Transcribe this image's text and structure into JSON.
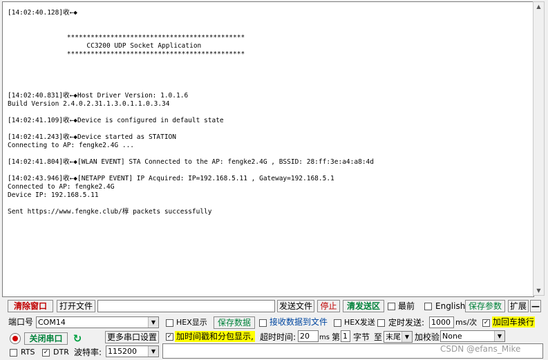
{
  "terminal": {
    "lines": [
      "[14:02:40.128]收←◆",
      "",
      "",
      "               *********************************************",
      "                    CC3200 UDP Socket Application",
      "               *********************************************",
      "",
      "",
      "",
      "",
      "[14:02:40.831]收←◆Host Driver Version: 1.0.1.6",
      "Build Version 2.4.0.2.31.1.3.0.1.1.0.3.34",
      "",
      "[14:02:41.109]收←◆Device is configured in default state",
      "",
      "[14:02:41.243]收←◆Device started as STATION",
      "Connecting to AP: fengke2.4G ...",
      "",
      "[14:02:41.804]收←◆[WLAN EVENT] STA Connected to the AP: fengke2.4G , BSSID: 28:ff:3e:a4:a8:4d",
      "",
      "[14:02:43.946]收←◆[NETAPP EVENT] IP Acquired: IP=192.168.5.11 , Gateway=192.168.5.1",
      "Connected to AP: fengke2.4G",
      "Device IP: 192.168.5.11",
      "",
      "Sent https://www.fengke.club/椁 packets successfully"
    ]
  },
  "toolbar1": {
    "clear_window": "清除窗口",
    "open_file": "打开文件",
    "file_path": "",
    "send_file": "发送文件",
    "stop": "停止",
    "clear_send": "清发送区",
    "latest_label": "最前",
    "english_label": "English",
    "save_params": "保存参数",
    "expand": "扩展",
    "collapse": "—"
  },
  "row2": {
    "port_label": "端口号",
    "port_value": "COM14",
    "hex_display_label": "HEX显示",
    "save_data": "保存数据",
    "recv_to_file_label": "接收数据到文件",
    "hex_send_label": "HEX发送",
    "timed_send_label": "定时发送:",
    "interval_value": "1000",
    "interval_unit": "ms/次",
    "add_crlf_label": "加回车换行"
  },
  "row3": {
    "close_port": "关闭串口",
    "more_settings": "更多串口设置",
    "timestamp_label": "加时间戳和分包显示,",
    "timeout_label": "超时时间:",
    "timeout_value": "20",
    "timeout_unit": "ms",
    "nth_label": "第",
    "nth_value": "1",
    "byte_label": "字节",
    "to_label": "至",
    "end_value": "末尾",
    "checksum_label": "加校验",
    "checksum_value": "None"
  },
  "row4": {
    "rts_label": "RTS",
    "dtr_label": "DTR",
    "baud_label": "波特率:",
    "baud_value": "115200"
  },
  "watermark": "CSDN @efans_Mike"
}
